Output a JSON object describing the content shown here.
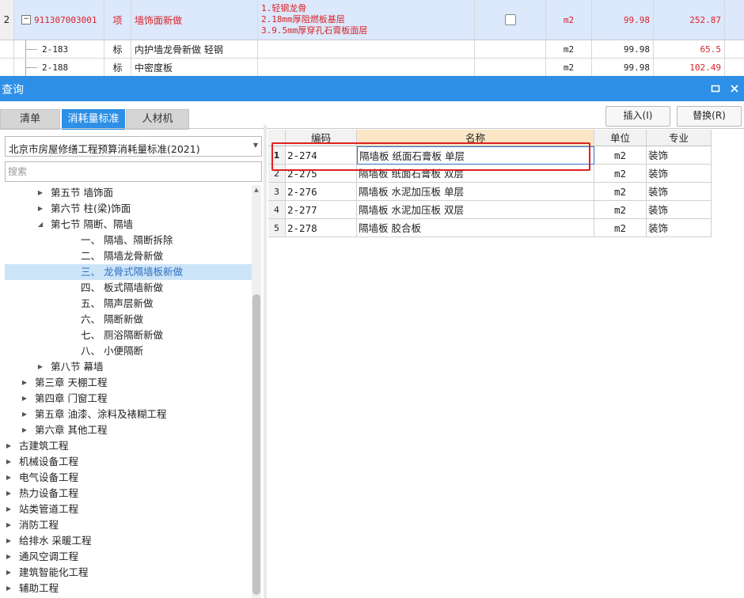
{
  "top_rows": [
    {
      "num": "2",
      "code": "911307003001",
      "type": "项",
      "name": "墙饰面新做",
      "desc": [
        "1.轻钢龙骨",
        "2.18mm厚阻燃板基层",
        "3.9.5mm厚穿孔石膏板面层"
      ],
      "unit": "m2",
      "qty": "99.98",
      "price": "252.87"
    },
    {
      "code": "2-183",
      "type": "标",
      "name": "内护墙龙骨新做 轻钢",
      "unit": "m2",
      "qty": "99.98",
      "price": "65.5"
    },
    {
      "code": "2-188",
      "type": "标",
      "name": "中密度板",
      "unit": "m2",
      "qty": "99.98",
      "price": "102.49"
    }
  ],
  "dialog": {
    "title": "查询",
    "tabs": [
      "清单",
      "消耗量标准",
      "人材机"
    ],
    "insert_label": "插入(I)",
    "replace_label": "替换(R)",
    "standard_selected": "北京市房屋修缮工程预算消耗量标准(2021)",
    "search_placeholder": "搜索"
  },
  "tree": [
    {
      "label": "第五节 墙饰面",
      "arrow": "▶"
    },
    {
      "label": "第六节 柱(梁)饰面",
      "arrow": "▶"
    },
    {
      "label": "第七节 隔断、隔墙",
      "arrow": "◢"
    },
    {
      "label": "一、 隔墙、隔断拆除",
      "arrow": ""
    },
    {
      "label": "二、 隔墙龙骨新做",
      "arrow": ""
    },
    {
      "label": "三、 龙骨式隔墙板新做",
      "arrow": ""
    },
    {
      "label": "四、 板式隔墙新做",
      "arrow": ""
    },
    {
      "label": "五、 隔声层新做",
      "arrow": ""
    },
    {
      "label": "六、 隔断新做",
      "arrow": ""
    },
    {
      "label": "七、 厕浴隔断新做",
      "arrow": ""
    },
    {
      "label": "八、 小便隔断",
      "arrow": ""
    },
    {
      "label": "第八节 幕墙",
      "arrow": "▶"
    },
    {
      "label": "第三章 天棚工程",
      "arrow": "▶"
    },
    {
      "label": "第四章 门窗工程",
      "arrow": "▶"
    },
    {
      "label": "第五章 油漆、涂料及裱糊工程",
      "arrow": "▶"
    },
    {
      "label": "第六章 其他工程",
      "arrow": "▶"
    },
    {
      "label": "古建筑工程",
      "arrow": "▶"
    },
    {
      "label": "机械设备工程",
      "arrow": "▶"
    },
    {
      "label": "电气设备工程",
      "arrow": "▶"
    },
    {
      "label": "热力设备工程",
      "arrow": "▶"
    },
    {
      "label": "站类管道工程",
      "arrow": "▶"
    },
    {
      "label": "消防工程",
      "arrow": "▶"
    },
    {
      "label": "给排水 采暖工程",
      "arrow": "▶"
    },
    {
      "label": "通风空调工程",
      "arrow": "▶"
    },
    {
      "label": "建筑智能化工程",
      "arrow": "▶"
    },
    {
      "label": "辅助工程",
      "arrow": "▶"
    }
  ],
  "table": {
    "headers": [
      "编码",
      "名称",
      "单位",
      "专业"
    ],
    "rows": [
      {
        "n": "1",
        "code": "2-274",
        "name": "隔墙板 纸面石膏板 单层",
        "unit": "m2",
        "major": "装饰"
      },
      {
        "n": "2",
        "code": "2-275",
        "name": "隔墙板 纸面石膏板 双层",
        "unit": "m2",
        "major": "装饰"
      },
      {
        "n": "3",
        "code": "2-276",
        "name": "隔墙板 水泥加压板 单层",
        "unit": "m2",
        "major": "装饰"
      },
      {
        "n": "4",
        "code": "2-277",
        "name": "隔墙板 水泥加压板 双层",
        "unit": "m2",
        "major": "装饰"
      },
      {
        "n": "5",
        "code": "2-278",
        "name": "隔墙板 胶合板",
        "unit": "m2",
        "major": "装饰"
      }
    ]
  },
  "colors": {
    "accent": "#2d8fe6",
    "highlight": "#e02020",
    "selected_bg": "#cce4f7",
    "top_selected_bg": "#dce8fb"
  }
}
